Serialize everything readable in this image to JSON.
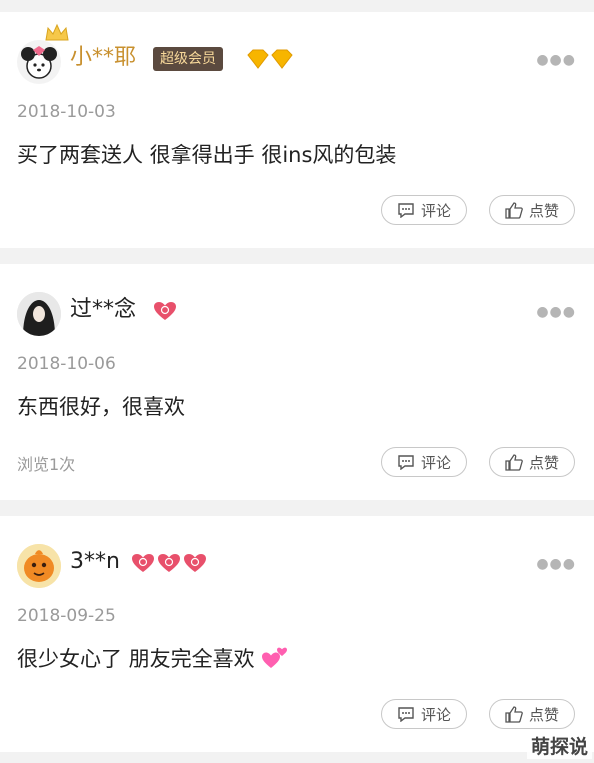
{
  "comments": [
    {
      "username": "小**耶",
      "badge": "超级会员",
      "date": "2018-10-03",
      "text": "买了两套送人 很拿得出手 很ins风的包装",
      "views": "",
      "comment_label": "评论",
      "like_label": "点赞"
    },
    {
      "username": "过**念",
      "date": "2018-10-06",
      "text": "东西很好，很喜欢",
      "views": "浏览1次",
      "comment_label": "评论",
      "like_label": "点赞"
    },
    {
      "username": "3**n",
      "date": "2018-09-25",
      "text": "很少女心了 朋友完全喜欢",
      "views": "",
      "comment_label": "评论",
      "like_label": "点赞"
    }
  ],
  "watermark": "萌探说",
  "colors": {
    "vip_name": "#c8902e",
    "name": "#222222",
    "gem": "#f5b400",
    "heart": "#e8506b"
  }
}
